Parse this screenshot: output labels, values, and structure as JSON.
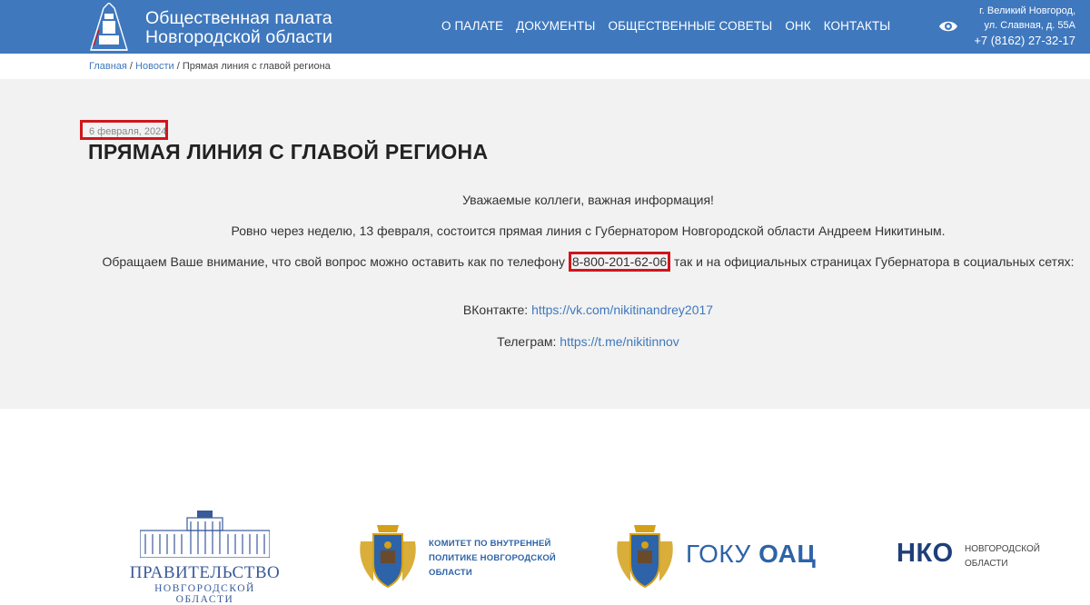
{
  "header": {
    "org_name_line1": "Общественная палата",
    "org_name_line2": "Новгородской области",
    "nav": [
      {
        "label": "О ПАЛАТЕ"
      },
      {
        "label": "ДОКУМЕНТЫ"
      },
      {
        "label": "ОБЩЕСТВЕННЫЕ СОВЕТЫ"
      },
      {
        "label": "ОНК"
      },
      {
        "label": "КОНТАКТЫ"
      }
    ],
    "address_line1": "г. Великий Новгород,",
    "address_line2": "ул. Славная, д. 55А",
    "phone": "+7 (8162) 27-32-17"
  },
  "breadcrumb": {
    "home": "Главная",
    "sep": " / ",
    "news": "Новости",
    "current": "Прямая линия с главой региона"
  },
  "article": {
    "date": "6 февраля, 2024",
    "title": "ПРЯМАЯ ЛИНИЯ С ГЛАВОЙ РЕГИОНА",
    "p1": "Уважаемые коллеги, важная информация!",
    "p2": "Ровно через неделю, 13 февраля, состоится прямая линия с Губернатором Новгородской области Андреем Никитиным.",
    "p3_before": "Обращаем Ваше внимание, что свой вопрос можно оставить как по телефону ",
    "p3_phone": "8-800-201-62-06",
    "p3_after": " так и на официальных страницах Губернатора в социальных сетях:",
    "vk_label": "ВКонтакте: ",
    "vk_link": "https://vk.com/nikitinandrey2017",
    "tg_label": "Телеграм: ",
    "tg_link": "https://t.me/nikitinnov"
  },
  "partners": {
    "gov_title": "ПРАВИТЕЛЬСТВО",
    "gov_sub": "НОВГОРОДСКОЙ ОБЛАСТИ",
    "committee_line1": "КОМИТЕТ ПО ВНУТРЕННЕЙ",
    "committee_line2": "ПОЛИТИКЕ НОВГОРОДСКОЙ",
    "committee_line3": "ОБЛАСТИ",
    "goku_light": "ГОКУ ",
    "goku_bold": "ОАЦ",
    "nko_mark": "НКО",
    "nko_line1": "НОВГОРОДСКОЙ",
    "nko_line2": "ОБЛАСТИ"
  },
  "colors": {
    "header_bg": "#3f78bd",
    "highlight_border": "#d0161c",
    "link": "#3f78bd",
    "article_bg": "#f2f2f2"
  }
}
